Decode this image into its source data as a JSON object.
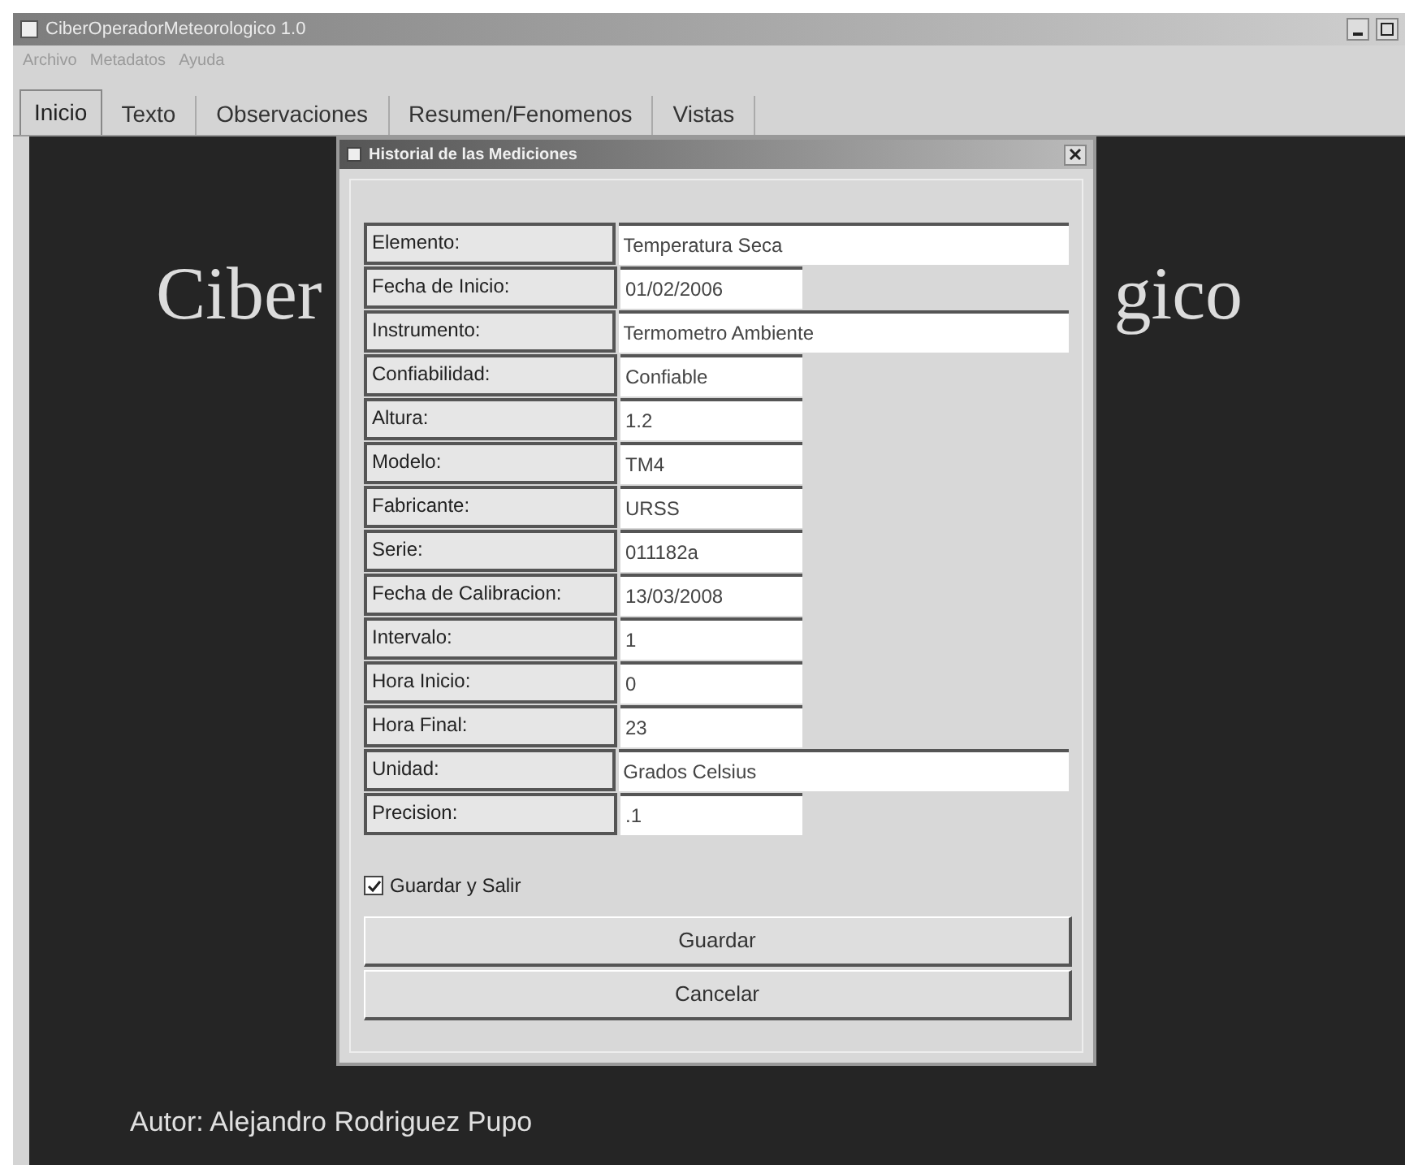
{
  "window": {
    "title": "CiberOperadorMeteorologico 1.0"
  },
  "menu": [
    "Archivo",
    "Metadatos",
    "Ayuda"
  ],
  "tabs": [
    {
      "label": "Inicio",
      "selected": true
    },
    {
      "label": "Texto",
      "selected": false
    },
    {
      "label": "Observaciones",
      "selected": false
    },
    {
      "label": "Resumen/Fenomenos",
      "selected": false
    },
    {
      "label": "Vistas",
      "selected": false
    }
  ],
  "main": {
    "heading_left": "Ciber",
    "heading_right": "gico",
    "author": "Autor: Alejandro Rodriguez Pupo"
  },
  "dialog": {
    "title": "Historial de las Mediciones",
    "fields": [
      {
        "label": "Elemento:",
        "value": "Temperatura Seca",
        "wide": true
      },
      {
        "label": "Fecha de Inicio:",
        "value": "01/02/2006",
        "wide": false
      },
      {
        "label": "Instrumento:",
        "value": "Termometro Ambiente",
        "wide": true
      },
      {
        "label": "Confiabilidad:",
        "value": "Confiable",
        "wide": false
      },
      {
        "label": "Altura:",
        "value": "1.2",
        "wide": false
      },
      {
        "label": "Modelo:",
        "value": "TM4",
        "wide": false
      },
      {
        "label": "Fabricante:",
        "value": "URSS",
        "wide": false
      },
      {
        "label": "Serie:",
        "value": "011182a",
        "wide": false
      },
      {
        "label": "Fecha de Calibracion:",
        "value": "13/03/2008",
        "wide": false
      },
      {
        "label": "Intervalo:",
        "value": "1",
        "wide": false
      },
      {
        "label": "Hora Inicio:",
        "value": "0",
        "wide": false
      },
      {
        "label": "Hora Final:",
        "value": "23",
        "wide": false
      },
      {
        "label": "Unidad:",
        "value": "Grados Celsius",
        "wide": true
      },
      {
        "label": "Precision:",
        "value": ".1",
        "wide": false
      }
    ],
    "checkbox": {
      "label": "Guardar y Salir",
      "checked": true
    },
    "buttons": [
      "Guardar",
      "Cancelar"
    ]
  }
}
